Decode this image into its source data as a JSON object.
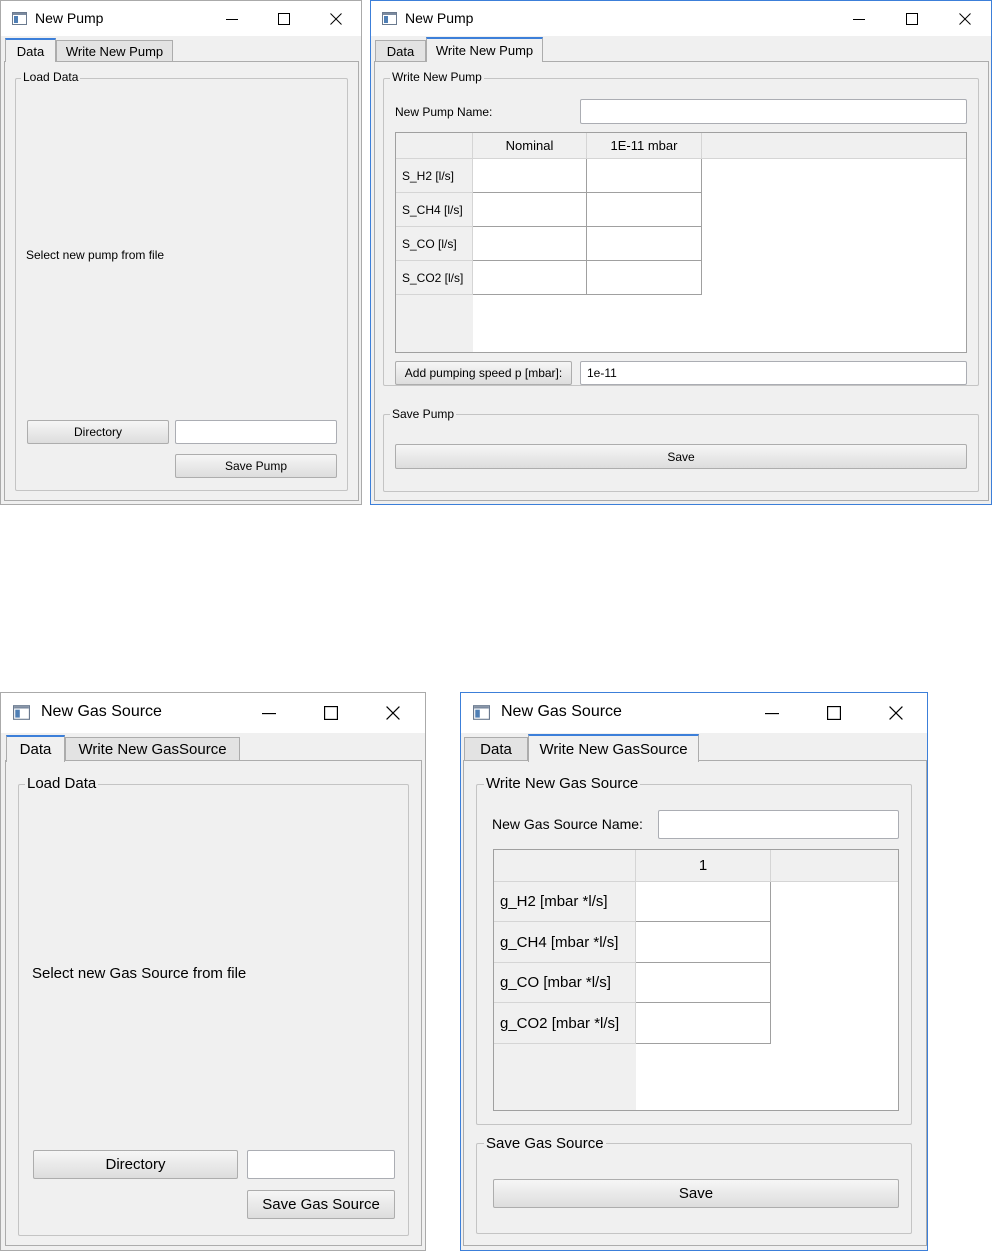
{
  "pump_data_window": {
    "title": "New Pump",
    "tabs": [
      "Data",
      "Write New Pump"
    ],
    "group_title": "Load Data",
    "prompt": "Select new pump from file",
    "directory_button": "Directory",
    "directory_value": "",
    "save_button": "Save Pump"
  },
  "pump_write_window": {
    "title": "New Pump",
    "tabs": [
      "Data",
      "Write New Pump"
    ],
    "group_title": "Write New Pump",
    "name_label": "New Pump Name:",
    "name_value": "",
    "table": {
      "columns": [
        "Nominal",
        "1E-11 mbar"
      ],
      "rows": [
        "S_H2 [l/s]",
        "S_CH4 [l/s]",
        "S_CO [l/s]",
        "S_CO2 [l/s]"
      ]
    },
    "add_speed_button": "Add pumping speed p [mbar]:",
    "add_speed_value": "1e-11",
    "save_group_title": "Save Pump",
    "save_button": "Save"
  },
  "gas_data_window": {
    "title": "New Gas Source",
    "tabs": [
      "Data",
      "Write New GasSource"
    ],
    "group_title": "Load Data",
    "prompt": "Select new Gas Source from file",
    "directory_button": "Directory",
    "directory_value": "",
    "save_button": "Save Gas Source"
  },
  "gas_write_window": {
    "title": "New Gas Source",
    "tabs": [
      "Data",
      "Write New GasSource"
    ],
    "group_title": "Write New Gas Source",
    "name_label": "New Gas Source Name:",
    "name_value": "",
    "table": {
      "columns": [
        "1"
      ],
      "rows": [
        "g_H2 [mbar *l/s]",
        "g_CH4 [mbar *l/s]",
        "g_CO [mbar *l/s]",
        "g_CO2 [mbar *l/s]"
      ]
    },
    "save_group_title": "Save Gas Source",
    "save_button": "Save"
  },
  "icons": {
    "app": "app-window-icon",
    "minimize": "minimize-icon",
    "maximize": "maximize-icon",
    "close": "close-icon"
  },
  "colors": {
    "accent": "#3c7fd9",
    "window_bg": "#f0f0f0"
  }
}
